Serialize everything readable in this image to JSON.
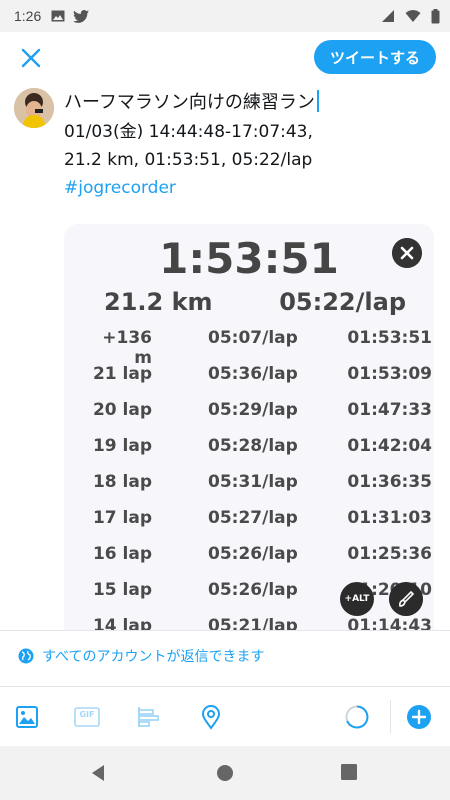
{
  "status_bar": {
    "time": "1:26"
  },
  "header": {
    "tweet_button": "ツイートする"
  },
  "compose": {
    "title": "ハーフマラソン向けの練習ラン",
    "line1": "01/03(金) 14:44:48-17:07:43,",
    "line2": "21.2 km, 01:53:51, 05:22/lap",
    "hashtag": "#jogrecorder"
  },
  "media": {
    "total_time": "1:53:51",
    "distance": "21.2 km",
    "avg_pace": "05:22/lap",
    "rows": [
      {
        "lap": "+136 m",
        "pace": "05:07/lap",
        "split": "01:53:51"
      },
      {
        "lap": "21 lap",
        "pace": "05:36/lap",
        "split": "01:53:09"
      },
      {
        "lap": "20 lap",
        "pace": "05:29/lap",
        "split": "01:47:33"
      },
      {
        "lap": "19 lap",
        "pace": "05:28/lap",
        "split": "01:42:04"
      },
      {
        "lap": "18 lap",
        "pace": "05:31/lap",
        "split": "01:36:35"
      },
      {
        "lap": "17 lap",
        "pace": "05:27/lap",
        "split": "01:31:03"
      },
      {
        "lap": "16 lap",
        "pace": "05:26/lap",
        "split": "01:25:36"
      },
      {
        "lap": "15 lap",
        "pace": "05:26/lap",
        "split": "01:20:10"
      },
      {
        "lap": "14 lap",
        "pace": "05:21/lap",
        "split": "01:14:43"
      }
    ],
    "alt_label": "+ALT"
  },
  "reply_setting": {
    "label": "すべてのアカウントが返信できます"
  },
  "toolbar": {
    "gif_label": "GIF"
  },
  "colors": {
    "accent": "#1da1f2",
    "text": "#14171a"
  }
}
